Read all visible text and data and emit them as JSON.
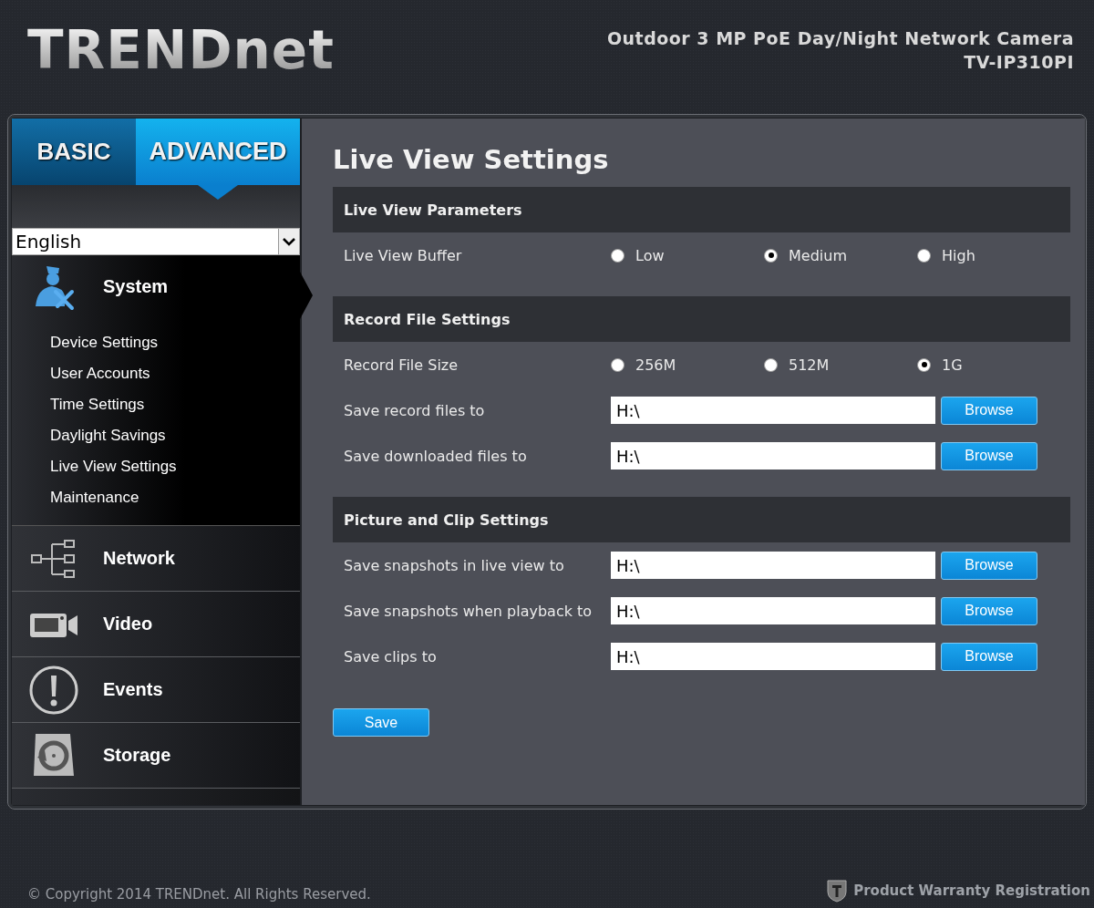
{
  "header": {
    "logo": "TRENDnet",
    "product_title": "Outdoor 3 MP PoE Day/Night Network Camera",
    "model": "TV-IP310PI"
  },
  "tabs": [
    {
      "label": "BASIC",
      "selected": false
    },
    {
      "label": "ADVANCED",
      "selected": true
    }
  ],
  "language": {
    "value": "English"
  },
  "nav": [
    {
      "label": "System",
      "selected": true,
      "children": [
        {
          "label": "Device Settings"
        },
        {
          "label": "User Accounts"
        },
        {
          "label": "Time Settings"
        },
        {
          "label": "Daylight Savings"
        },
        {
          "label": "Live View Settings"
        },
        {
          "label": "Maintenance"
        }
      ]
    },
    {
      "label": "Network",
      "selected": false
    },
    {
      "label": "Video",
      "selected": false
    },
    {
      "label": "Events",
      "selected": false
    },
    {
      "label": "Storage",
      "selected": false
    }
  ],
  "content": {
    "title": "Live View Settings",
    "sections": [
      {
        "title": "Live View Parameters",
        "rows": [
          {
            "kind": "radio",
            "label": "Live View Buffer",
            "options": [
              {
                "label": "Low",
                "selected": false
              },
              {
                "label": "Medium",
                "selected": true
              },
              {
                "label": "High",
                "selected": false
              }
            ]
          }
        ]
      },
      {
        "title": "Record File Settings",
        "rows": [
          {
            "kind": "radio",
            "label": "Record File Size",
            "options": [
              {
                "label": "256M",
                "selected": false
              },
              {
                "label": "512M",
                "selected": false
              },
              {
                "label": "1G",
                "selected": true
              }
            ]
          },
          {
            "kind": "path",
            "label": "Save record files to",
            "value": "H:\\",
            "button": "Browse"
          },
          {
            "kind": "path",
            "label": "Save downloaded files to",
            "value": "H:\\",
            "button": "Browse"
          }
        ]
      },
      {
        "title": "Picture and Clip Settings",
        "rows": [
          {
            "kind": "path",
            "label": "Save snapshots in live view to",
            "value": "H:\\",
            "button": "Browse"
          },
          {
            "kind": "path",
            "label": "Save snapshots when playback to",
            "value": "H:\\",
            "button": "Browse"
          },
          {
            "kind": "path",
            "label": "Save clips to",
            "value": "H:\\",
            "button": "Browse"
          }
        ]
      }
    ],
    "save_button": "Save"
  },
  "footer": {
    "copyright": "© Copyright 2014 TRENDnet. All Rights Reserved.",
    "warranty_link": "Product Warranty Registration"
  }
}
